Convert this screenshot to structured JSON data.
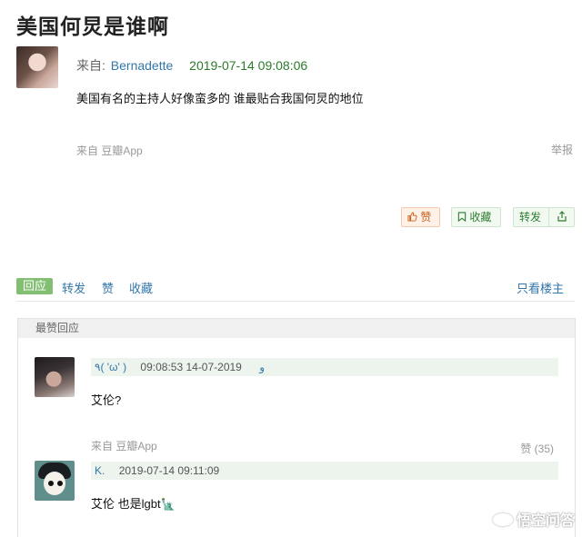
{
  "post": {
    "title": "美国何炅是谁啊",
    "from_label": "来自:",
    "author": "Bernadette",
    "timestamp": "2019-07-14 09:08:06",
    "body": "美国有名的主持人好像蛮多的 谁最贴合我国何炅的地位",
    "source": "来自 豆瓣App",
    "report": "举报"
  },
  "buttons": {
    "like": "赞",
    "like_icon": "thumbs-up-icon",
    "favorite": "收藏",
    "favorite_icon": "bookmark-icon",
    "repost": "转发",
    "share_icon": "share-icon"
  },
  "action_bar": {
    "reply": "回应",
    "repost": "转发",
    "like": "赞",
    "favorite": "收藏",
    "only_op": "只看楼主"
  },
  "replies_panel": {
    "header": "最赞回应",
    "replies": [
      {
        "user": "٩( 'ω' )",
        "time": "09:08:53 14-07-2019",
        "extra": "و",
        "text": "艾伦?",
        "source": "来自 豆瓣App",
        "likes": "赞 (35)"
      },
      {
        "user": "K.",
        "time": "2019-07-14 09:11:09",
        "text": "艾伦 也是lgbt🗽"
      }
    ]
  },
  "watermark": "悟空问答",
  "colors": {
    "link_blue": "#3377aa",
    "time_green": "#2a7a2a",
    "reply_tag_green": "#83bf73",
    "like_orange": "#c8601c"
  }
}
